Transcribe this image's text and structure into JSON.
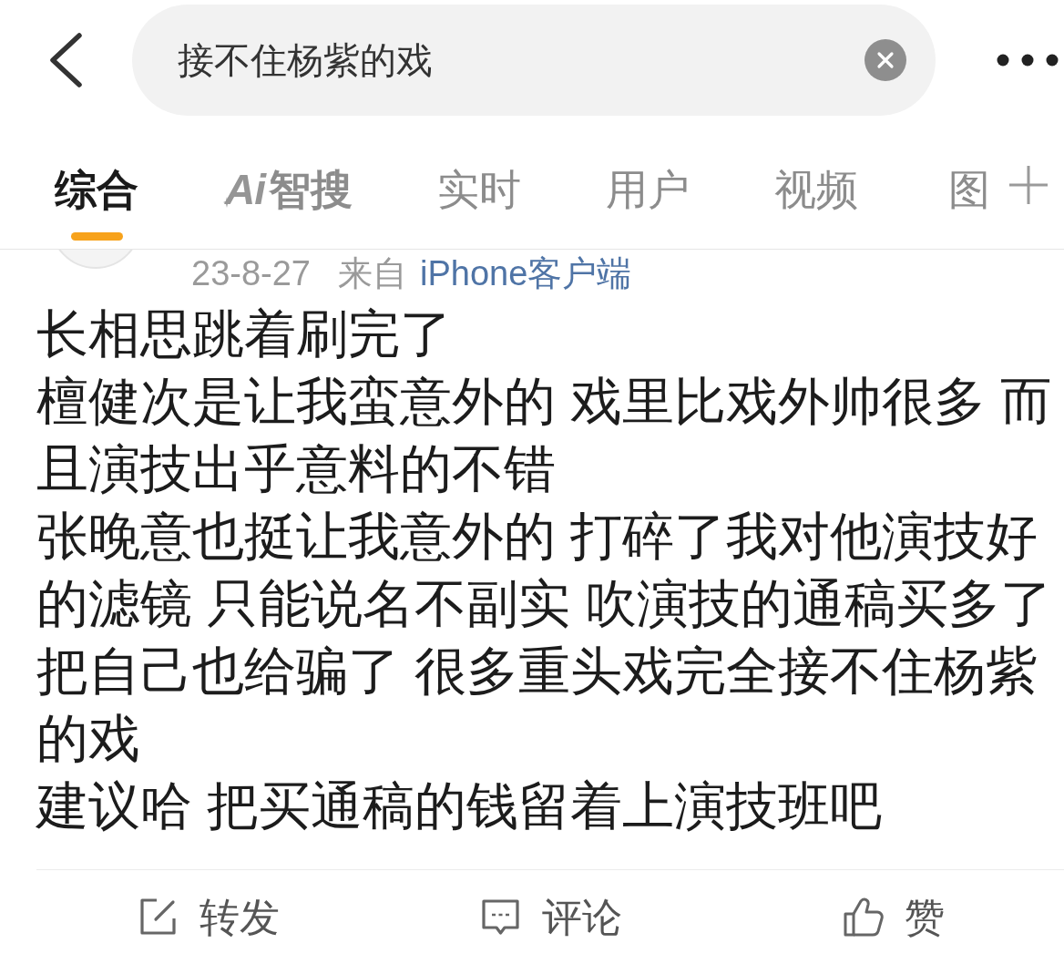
{
  "search_bar": {
    "query": "接不住杨紫的戏"
  },
  "tabs": [
    {
      "label": "综合",
      "kind": "text",
      "selected": true
    },
    {
      "prefix": "Ai",
      "label": "智搜",
      "kind": "ai",
      "selected": false
    },
    {
      "label": "实时",
      "kind": "text",
      "selected": false
    },
    {
      "label": "用户",
      "kind": "text",
      "selected": false
    },
    {
      "label": "视频",
      "kind": "text",
      "selected": false
    },
    {
      "label": "图",
      "kind": "text",
      "selected": false
    }
  ],
  "post": {
    "meta": {
      "date": "23-8-27",
      "source_prefix": "来自",
      "source": "iPhone客户端"
    },
    "paragraphs": [
      "长相思跳着刷完了",
      "檀健次是让我蛮意外的 戏里比戏外帅很多 而且演技出乎意料的不错",
      "张晚意也挺让我意外的 打碎了我对他演技好的滤镜 只能说名不副实 吹演技的通稿买多了把自己也给骗了 很多重头戏完全接不住杨紫的戏",
      "建议哈 把买通稿的钱留着上演技班吧"
    ]
  },
  "actions": [
    {
      "kind": "repost",
      "label": "转发"
    },
    {
      "kind": "comment",
      "label": "评论"
    },
    {
      "kind": "like",
      "label": "赞"
    }
  ]
}
